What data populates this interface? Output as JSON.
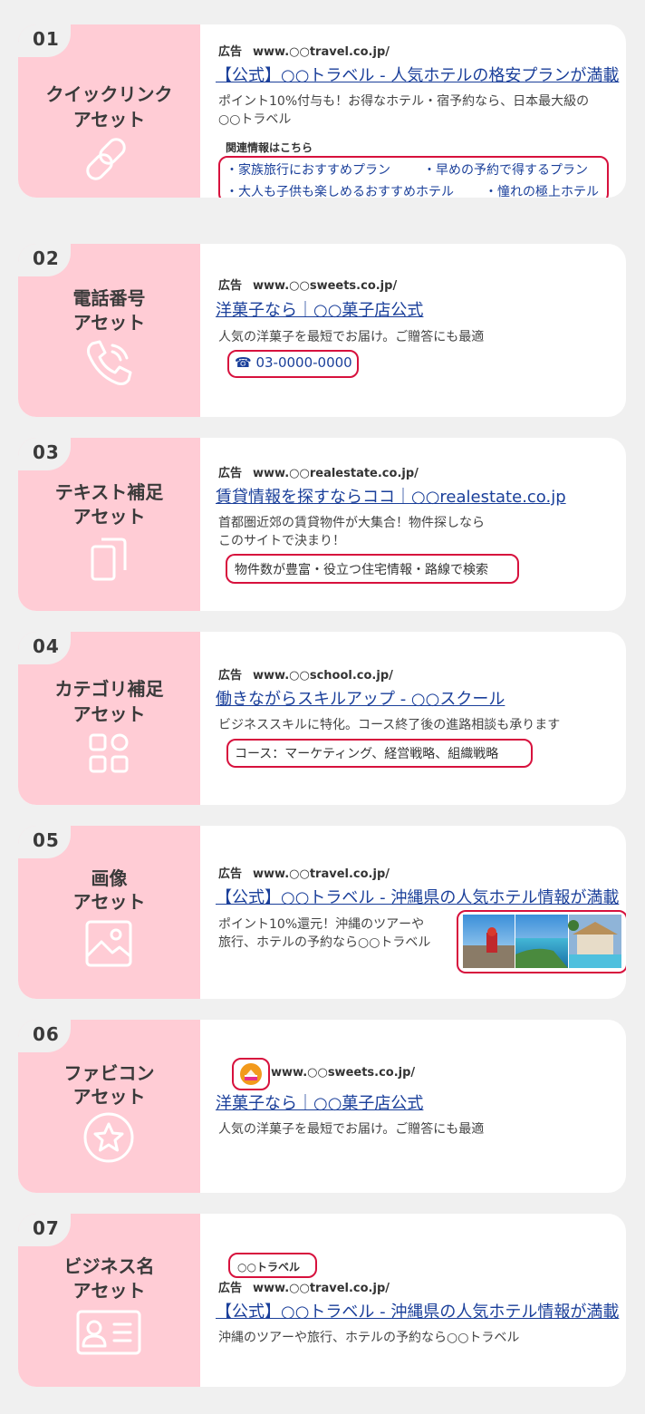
{
  "cards": [
    {
      "num": "01",
      "title1": "クイックリンク",
      "title2": "アセット",
      "icon": "link-icon",
      "ad_label": "広告",
      "url": "www.○○travel.co.jp/",
      "headline": "【公式】○○トラベル - 人気ホテルの格安プランが満載",
      "desc1": "ポイント10%付与も！お得なホテル・宿予約なら、日本最大級の",
      "desc2": "○○トラベル",
      "related_label": "関連情報はこちら",
      "sitelinks": [
        "・家族旅行におすすめプラン",
        "・早めの予約で得するプラン",
        "・大人も子供も楽しめるおすすめホテル",
        "・憧れの極上ホテル"
      ]
    },
    {
      "num": "02",
      "title1": "電話番号",
      "title2": "アセット",
      "icon": "phone-icon",
      "ad_label": "広告",
      "url": "www.○○sweets.co.jp/",
      "headline": "洋菓子なら｜○○菓子店公式",
      "desc1": "人気の洋菓子を最短でお届け。ご贈答にも最適",
      "phone": "☎ 03-0000-0000"
    },
    {
      "num": "03",
      "title1": "テキスト補足",
      "title2": "アセット",
      "icon": "copy-icon",
      "ad_label": "広告",
      "url": "www.○○realestate.co.jp/",
      "headline": "賃貸情報を探すならココ｜○○realestate.co.jp",
      "desc1": "首都圏近郊の賃貸物件が大集合！物件探しなら",
      "desc2": "このサイトで決まり！",
      "callout": "物件数が豊富・役立つ住宅情報・路線で検索"
    },
    {
      "num": "04",
      "title1": "カテゴリ補足",
      "title2": "アセット",
      "icon": "grid-icon",
      "ad_label": "広告",
      "url": "www.○○school.co.jp/",
      "headline": "働きながらスキルアップ - ○○スクール",
      "desc1": "ビジネススキルに特化。コース終了後の進路相談も承ります",
      "callout": "コース：マーケティング、経営戦略、組織戦略"
    },
    {
      "num": "05",
      "title1": "画像",
      "title2": "アセット",
      "icon": "image-icon",
      "ad_label": "広告",
      "url": "www.○○travel.co.jp/",
      "headline": "【公式】○○トラベル - 沖縄県の人気ホテル情報が満載",
      "desc1": "ポイント10%還元！沖縄のツアーや",
      "desc2": "旅行、ホテルの予約なら○○トラベル"
    },
    {
      "num": "06",
      "title1": "ファビコン",
      "title2": "アセット",
      "icon": "star-icon",
      "url": "www.○○sweets.co.jp/",
      "headline": "洋菓子なら｜○○菓子店公式",
      "desc1": "人気の洋菓子を最短でお届け。ご贈答にも最適"
    },
    {
      "num": "07",
      "title1": "ビジネス名",
      "title2": "アセット",
      "icon": "id-card-icon",
      "business_name": "○○トラベル",
      "ad_label": "広告",
      "url": "www.○○travel.co.jp/",
      "headline": "【公式】○○トラベル - 沖縄県の人気ホテル情報が満載",
      "desc1": "沖縄のツアーや旅行、ホテルの予約なら○○トラベル"
    }
  ],
  "colors": {
    "background": "#f0f0f0",
    "card_left": "#ffccd5",
    "highlight": "#d7113d",
    "link": "#1a3f9a"
  }
}
